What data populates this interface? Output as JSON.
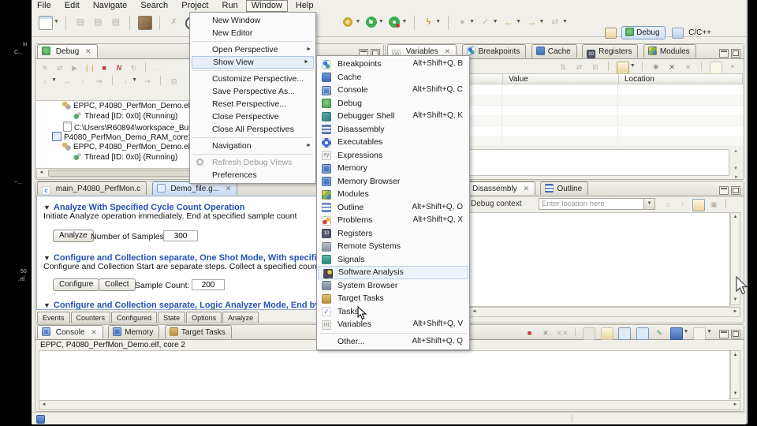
{
  "colors": {
    "accent_blue": "#2353b4",
    "menu_highlight": "#e6eef9",
    "active_tab_blue": "#c6daf2",
    "terminate_red": "#c03838",
    "suspend_yellow": "#e0c244",
    "run_green": "#3fae4e",
    "chrome_bg": "#f1efe9"
  },
  "desktop_fragments": {
    "a": "in",
    "b": "C...",
    "c": "~...",
    "d": "50",
    "e": ".rtf"
  },
  "menubar": {
    "file": "File",
    "edit": "Edit",
    "navigate": "Navigate",
    "search": "Search",
    "project": "Project",
    "run": "Run",
    "window": "Window",
    "help": "Help"
  },
  "perspectives": {
    "debug": "Debug",
    "cpp": "C/C++"
  },
  "window_menu": {
    "new_window": "New Window",
    "new_editor": "New Editor",
    "open_perspective": "Open Perspective",
    "show_view": "Show View",
    "customize_perspective": "Customize Perspective...",
    "save_perspective_as": "Save Perspective As...",
    "reset_perspective": "Reset Perspective...",
    "close_perspective": "Close Perspective",
    "close_all_perspectives": "Close All Perspectives",
    "navigation": "Navigation",
    "refresh_debug_views": "Refresh Debug Views",
    "preferences": "Preferences"
  },
  "show_view": {
    "breakpoints": {
      "label": "Breakpoints",
      "shortcut": "Alt+Shift+Q, B"
    },
    "cache": {
      "label": "Cache",
      "shortcut": ""
    },
    "console": {
      "label": "Console",
      "shortcut": "Alt+Shift+Q, C"
    },
    "debug": {
      "label": "Debug",
      "shortcut": ""
    },
    "debugger_shell": {
      "label": "Debugger Shell",
      "shortcut": "Alt+Shift+Q, K"
    },
    "disassembly": {
      "label": "Disassembly",
      "shortcut": ""
    },
    "executables": {
      "label": "Executables",
      "shortcut": ""
    },
    "expressions": {
      "label": "Expressions",
      "shortcut": ""
    },
    "memory": {
      "label": "Memory",
      "shortcut": ""
    },
    "memory_browser": {
      "label": "Memory Browser",
      "shortcut": ""
    },
    "modules": {
      "label": "Modules",
      "shortcut": ""
    },
    "outline": {
      "label": "Outline",
      "shortcut": "Alt+Shift+Q, O"
    },
    "problems": {
      "label": "Problems",
      "shortcut": "Alt+Shift+Q, X"
    },
    "registers": {
      "label": "Registers",
      "shortcut": ""
    },
    "remote_systems": {
      "label": "Remote Systems",
      "shortcut": ""
    },
    "signals": {
      "label": "Signals",
      "shortcut": ""
    },
    "software_analysis": {
      "label": "Software Analysis",
      "shortcut": ""
    },
    "system_browser": {
      "label": "System Browser",
      "shortcut": ""
    },
    "target_tasks": {
      "label": "Target Tasks",
      "shortcut": ""
    },
    "tasks": {
      "label": "Tasks",
      "shortcut": ""
    },
    "variables": {
      "label": "Variables",
      "shortcut": "Alt+Shift+Q, V"
    },
    "other": {
      "label": "Other...",
      "shortcut": "Alt+Shift+Q, Q"
    }
  },
  "debug_panel": {
    "tab": "Debug",
    "tree": [
      {
        "label": "EPPC, P4080_PerfMon_Demo.elf, cor..."
      },
      {
        "label": "Thread [ID: 0x0] (Running)"
      },
      {
        "label": "C:\\Users\\R60894\\workspace_Build_12..."
      },
      {
        "label": "P4080_PerfMon_Demo_RAM_core1_P408..."
      },
      {
        "label": "EPPC, P4080_PerfMon_Demo.elf, cor..."
      },
      {
        "label": "Thread [ID: 0x0] (Running)"
      }
    ]
  },
  "variables_panel": {
    "tab_variables": "Variables",
    "tab_breakpoints": "Breakpoints",
    "tab_cache": "Cache",
    "tab_registers": "Registers",
    "tab_modules": "Modules",
    "col_value": "Value",
    "col_location": "Location"
  },
  "editor": {
    "tab_main": "main_P4080_PerfMon.c",
    "tab_demo": "Demo_file.g...",
    "s1_title": "Analyze With Specified Cycle Count Operation",
    "s1_desc": "Initiate Analyze operation immediately. End at specified sample count",
    "analyze_button": "Analyze",
    "samples_label": "Number of Samples:",
    "samples_value": "300",
    "s2_title": "Configure and Collection separate, One Shot Mode, With specified Sample count",
    "s2_desc": "Configure and Collection Start are separate steps.  Collect a specified count after Collec",
    "configure_button": "Configure",
    "collect_button": "Collect",
    "sample_count_label": "Sample Count:",
    "sample_count_value": "200",
    "s3_title": "Configure and Collection separate, Logic Analyzer Mode, End by pressing Cancel",
    "bottom_tabs": [
      "Events",
      "Counters",
      "Configured",
      "State",
      "Options",
      "Analyze"
    ]
  },
  "disassembly_panel": {
    "tab_disassembly": "Disassembly",
    "tab_outline": "Outline",
    "context_label": "Debug context",
    "location_placeholder": "Enter location here"
  },
  "console_panel": {
    "tab_console": "Console",
    "tab_memory": "Memory",
    "tab_target_tasks": "Target Tasks",
    "process_label": "EPPC, P4080_PerfMon_Demo.elf, core 2"
  }
}
